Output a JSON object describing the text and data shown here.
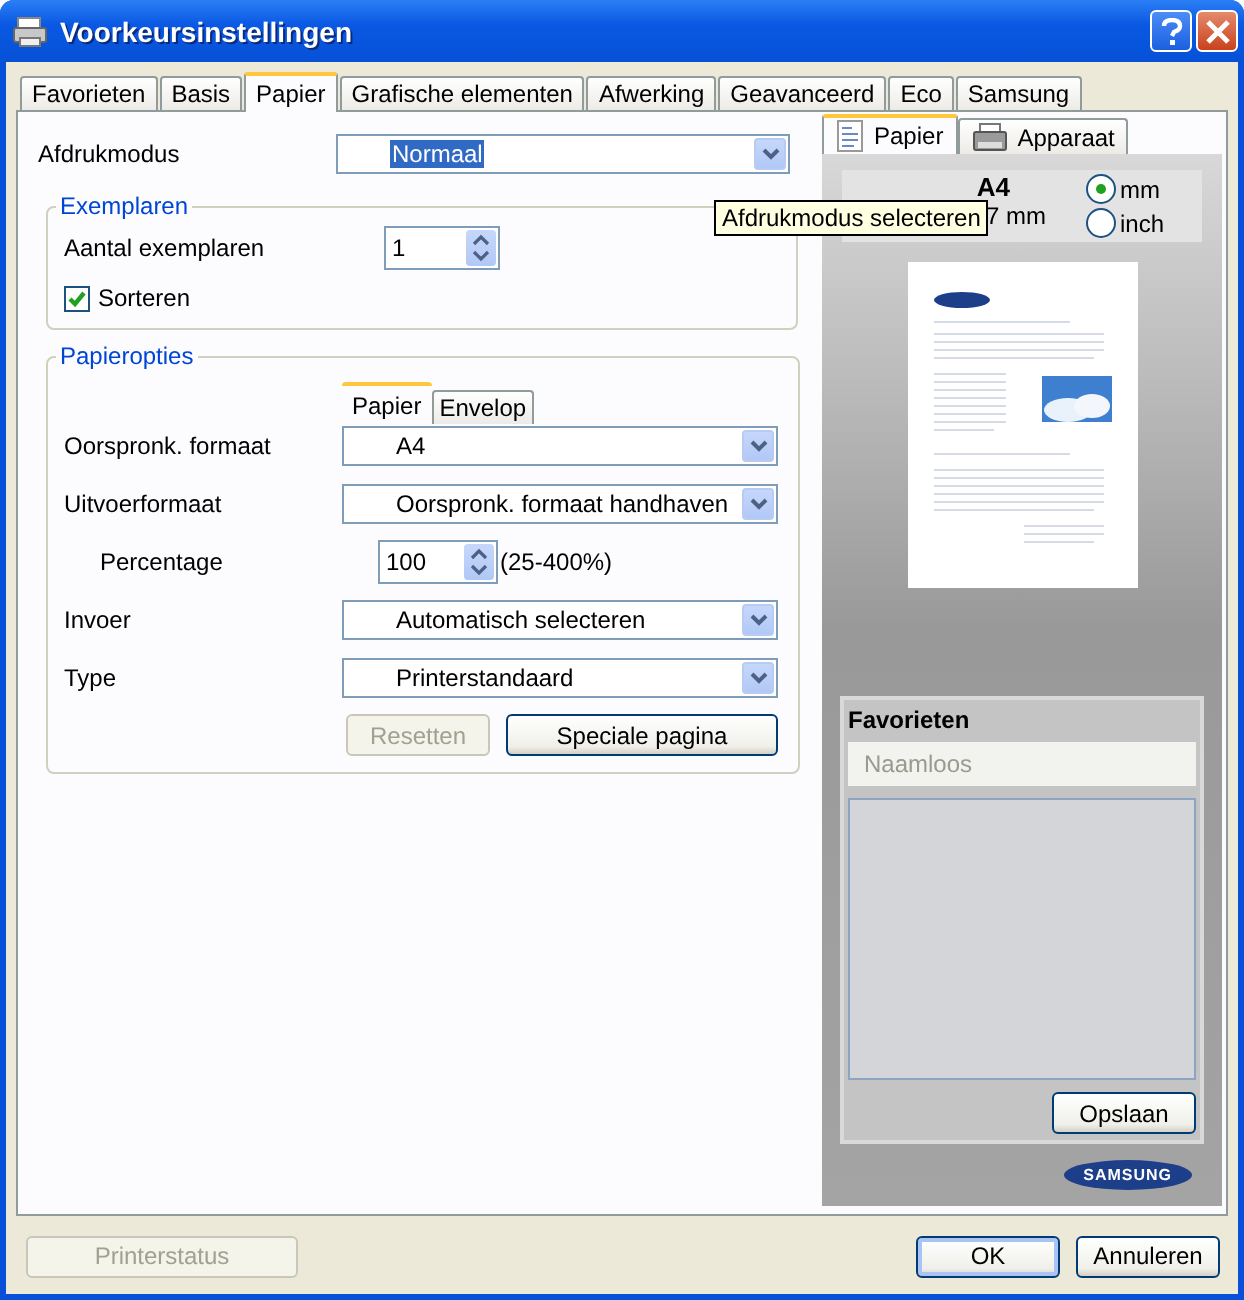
{
  "window": {
    "title": "Voorkeursinstellingen"
  },
  "tabs": [
    {
      "label": "Favorieten",
      "selected": false
    },
    {
      "label": "Basis",
      "selected": false
    },
    {
      "label": "Papier",
      "selected": true
    },
    {
      "label": "Grafische elementen",
      "selected": false
    },
    {
      "label": "Afwerking",
      "selected": false
    },
    {
      "label": "Geavanceerd",
      "selected": false
    },
    {
      "label": "Eco",
      "selected": false
    },
    {
      "label": "Samsung",
      "selected": false
    }
  ],
  "print_mode": {
    "label": "Afdrukmodus",
    "value": "Normaal",
    "tooltip": "Afdrukmodus selecteren"
  },
  "copies": {
    "title": "Exemplaren",
    "label": "Aantal exemplaren",
    "value": "1",
    "collate": {
      "label": "Sorteren",
      "checked": true
    }
  },
  "paper_options": {
    "title": "Papieropties",
    "tabs": [
      {
        "label": "Papier",
        "selected": true
      },
      {
        "label": "Envelop",
        "selected": false
      }
    ],
    "rows": [
      {
        "kind": "select",
        "label": "Oorspronk. formaat",
        "value": "A4"
      },
      {
        "kind": "select",
        "label": "Uitvoerformaat",
        "value": "Oorspronk. formaat handhaven"
      },
      {
        "kind": "spin",
        "label": "Percentage",
        "value": "100",
        "range": "(25-400%)"
      },
      {
        "kind": "select",
        "label": "Invoer",
        "value": "Automatisch selecteren"
      },
      {
        "kind": "select",
        "label": "Type",
        "value": "Printerstandaard"
      }
    ],
    "buttons": [
      {
        "label": "Resetten",
        "disabled": true
      },
      {
        "label": "Speciale pagina",
        "disabled": false
      }
    ]
  },
  "preview": {
    "tabs": [
      {
        "label": "Papier",
        "kind": "paper",
        "selected": true
      },
      {
        "label": "Apparaat",
        "kind": "printer",
        "selected": false
      }
    ],
    "size": "A4",
    "dimensions": "7 mm",
    "units": [
      {
        "label": "mm",
        "selected": true
      },
      {
        "label": "inch",
        "selected": false
      }
    ]
  },
  "favorites": {
    "title": "Favorieten",
    "placeholder": "Naamloos",
    "save": "Opslaan"
  },
  "logo": "SAMSUNG",
  "footer": {
    "status": {
      "label": "Printerstatus",
      "disabled": true
    },
    "buttons": [
      "OK",
      "Annuleren"
    ]
  }
}
